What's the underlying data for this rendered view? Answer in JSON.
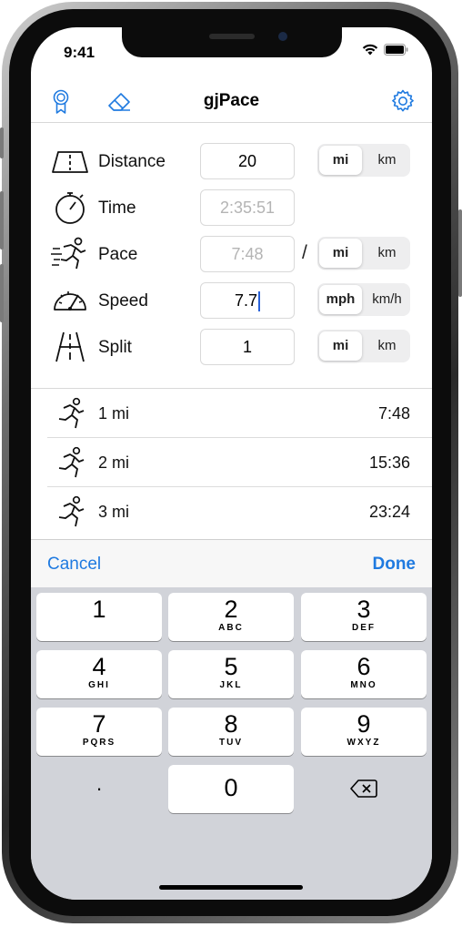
{
  "status": {
    "time": "9:41"
  },
  "nav": {
    "title": "gjPace",
    "icons": [
      "award-icon",
      "eraser-icon",
      "settings-gear-icon"
    ]
  },
  "colors": {
    "accent": "#1f7ae0",
    "cursor": "#2b63d9"
  },
  "inputs": {
    "distance": {
      "label": "Distance",
      "value": "20",
      "units": [
        "mi",
        "km"
      ],
      "selected": "mi"
    },
    "time": {
      "label": "Time",
      "placeholder": "2:35:51"
    },
    "pace": {
      "label": "Pace",
      "placeholder": "7:48",
      "separator": "/",
      "units": [
        "mi",
        "km"
      ],
      "selected": "mi"
    },
    "speed": {
      "label": "Speed",
      "value": "7.7",
      "units": [
        "mph",
        "km/h"
      ],
      "selected": "mph"
    },
    "split": {
      "label": "Split",
      "value": "1",
      "units": [
        "mi",
        "km"
      ],
      "selected": "mi"
    }
  },
  "splits": [
    {
      "label": "1 mi",
      "time": "7:48"
    },
    {
      "label": "2 mi",
      "time": "15:36"
    },
    {
      "label": "3 mi",
      "time": "23:24"
    }
  ],
  "keyboard": {
    "cancel": "Cancel",
    "done": "Done",
    "keys": [
      {
        "num": "1",
        "letters": ""
      },
      {
        "num": "2",
        "letters": "ABC"
      },
      {
        "num": "3",
        "letters": "DEF"
      },
      {
        "num": "4",
        "letters": "GHI"
      },
      {
        "num": "5",
        "letters": "JKL"
      },
      {
        "num": "6",
        "letters": "MNO"
      },
      {
        "num": "7",
        "letters": "PQRS"
      },
      {
        "num": "8",
        "letters": "TUV"
      },
      {
        "num": "9",
        "letters": "WXYZ"
      },
      {
        "num": "0",
        "letters": ""
      }
    ],
    "decimal": "."
  }
}
